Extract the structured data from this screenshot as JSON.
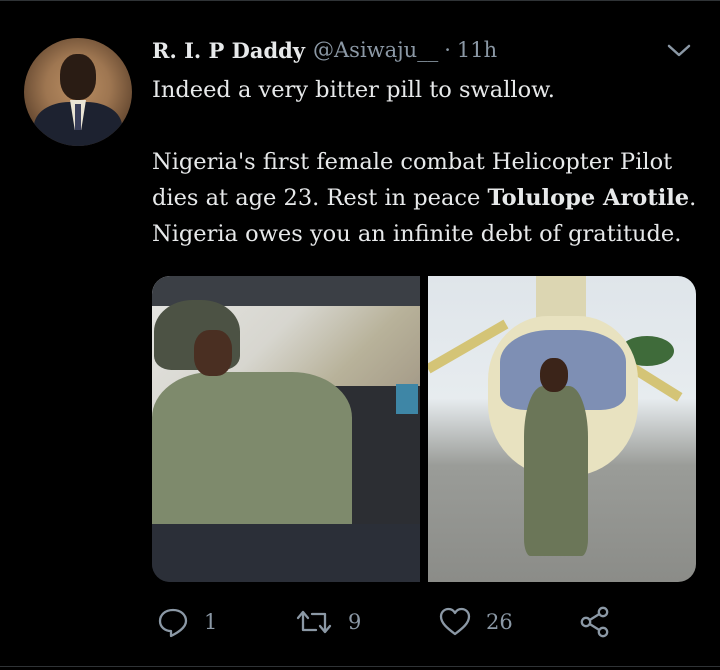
{
  "tweet": {
    "author_name": "R. I. P Daddy",
    "handle": "@Asiwaju__",
    "separator": "·",
    "time": "11h",
    "text_line1": "Indeed a very bitter pill to swallow.",
    "text_line2a": "Nigeria's first female combat Helicopter Pilot",
    "text_line3a": "dies at age 23. Rest in peace ",
    "text_line3_bold": "Tolulope Arotile",
    "text_line3b": ".",
    "text_line4": "Nigeria owes you an infinite debt of gratitude."
  },
  "actions": {
    "reply_count": "1",
    "retweet_count": "9",
    "like_count": "26"
  },
  "icons": {
    "menu": "chevron-down-icon",
    "reply": "reply-icon",
    "retweet": "retweet-icon",
    "like": "heart-icon",
    "share": "share-icon"
  },
  "colors": {
    "background": "#000000",
    "text": "#e7e9ea",
    "muted": "#8b98a5"
  }
}
